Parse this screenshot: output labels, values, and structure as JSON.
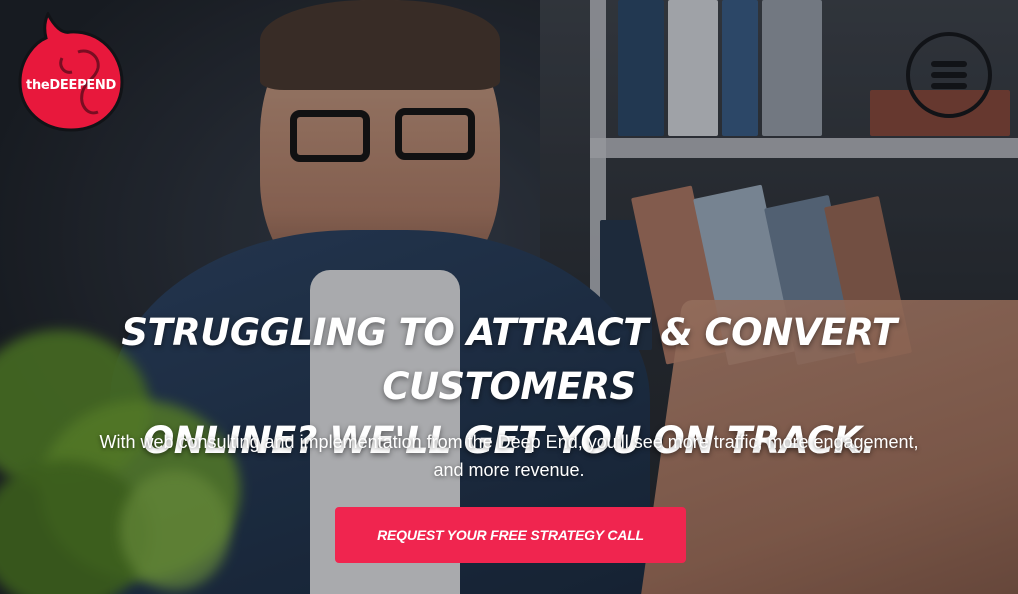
{
  "logo": {
    "text": "theDEEPEND",
    "brand_color": "#e8183c"
  },
  "menu": {
    "icon": "hamburger-menu-icon"
  },
  "hero": {
    "headline_line1": "STRUGGLING TO ATTRACT & CONVERT CUSTOMERS",
    "headline_line2": "ONLINE? WE'LL GET YOU ON TRACK.",
    "subtext_line1": "With web consulting and implementation from the Deep End, you’ll see more traffic, more engagement,",
    "subtext_line2": "and more revenue.",
    "cta_label": "REQUEST YOUR FREE STRATEGY CALL",
    "cta_color": "#f0254f"
  }
}
